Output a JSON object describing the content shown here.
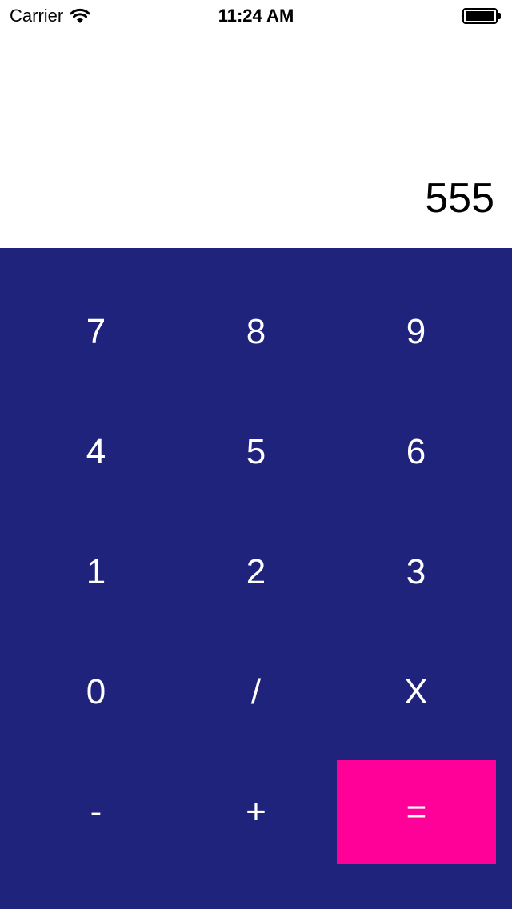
{
  "status_bar": {
    "carrier": "Carrier",
    "time": "11:24 AM",
    "wifi_icon": "wifi-icon",
    "battery_icon": "battery-icon",
    "battery_level": 1.0
  },
  "display": {
    "value": "555"
  },
  "colors": {
    "keypad_background": "#1f237c",
    "equals_background": "#ff0099",
    "key_text": "#ffffff"
  },
  "keypad": {
    "rows": [
      [
        "7",
        "8",
        "9"
      ],
      [
        "4",
        "5",
        "6"
      ],
      [
        "1",
        "2",
        "3"
      ],
      [
        "0",
        "/",
        "X"
      ],
      [
        "-",
        "+",
        "="
      ]
    ]
  }
}
